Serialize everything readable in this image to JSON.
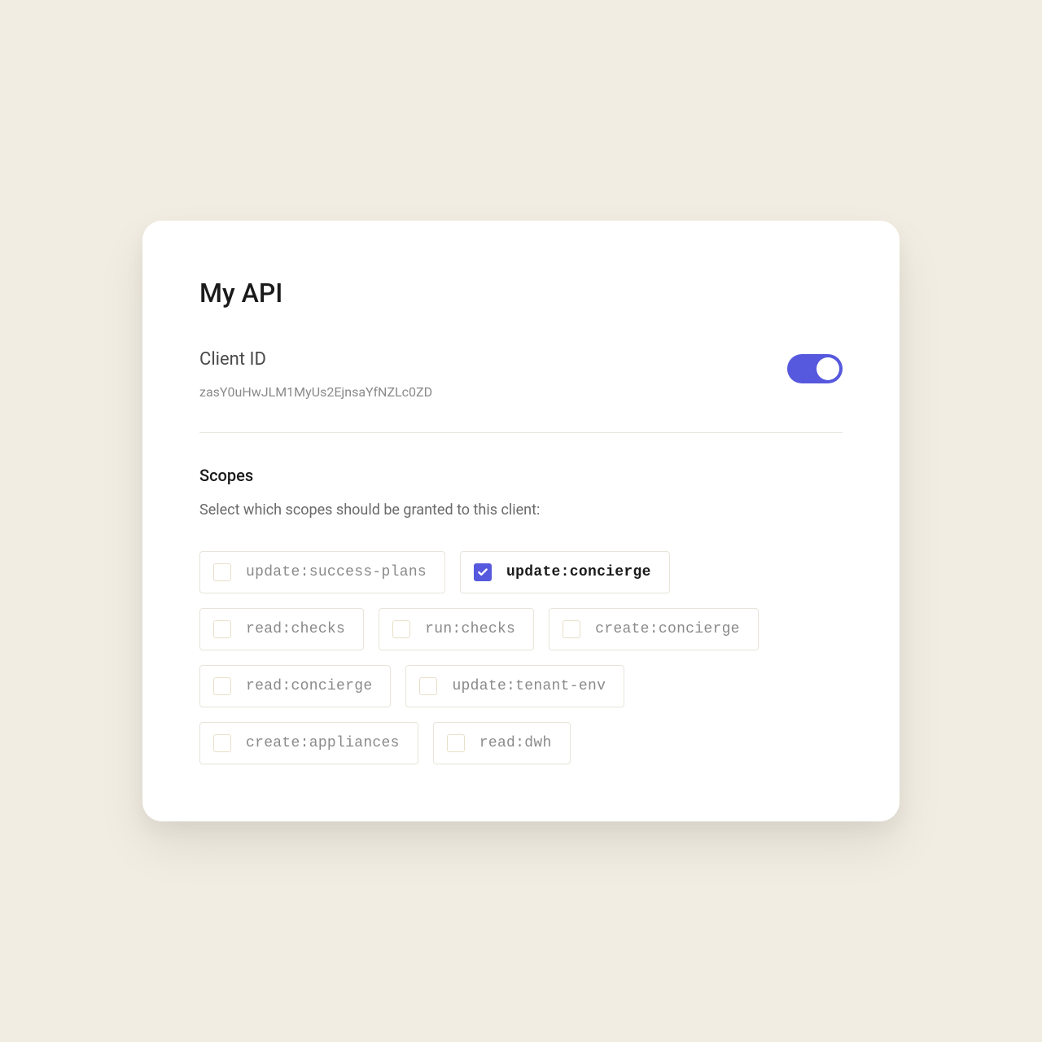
{
  "title": "My API",
  "client": {
    "label": "Client ID",
    "value": "zasY0uHwJLM1MyUs2EjnsaYfNZLc0ZD",
    "enabled": true
  },
  "scopes": {
    "heading": "Scopes",
    "description": "Select which scopes should be granted to this client:",
    "items": [
      {
        "label": "update:success-plans",
        "checked": false
      },
      {
        "label": "update:concierge",
        "checked": true
      },
      {
        "label": "read:checks",
        "checked": false
      },
      {
        "label": "run:checks",
        "checked": false
      },
      {
        "label": "create:concierge",
        "checked": false
      },
      {
        "label": "read:concierge",
        "checked": false
      },
      {
        "label": "update:tenant-env",
        "checked": false
      },
      {
        "label": "create:appliances",
        "checked": false
      },
      {
        "label": "read:dwh",
        "checked": false
      }
    ]
  },
  "colors": {
    "accent": "#5658dd",
    "background": "#f2ede2",
    "card": "#ffffff"
  }
}
